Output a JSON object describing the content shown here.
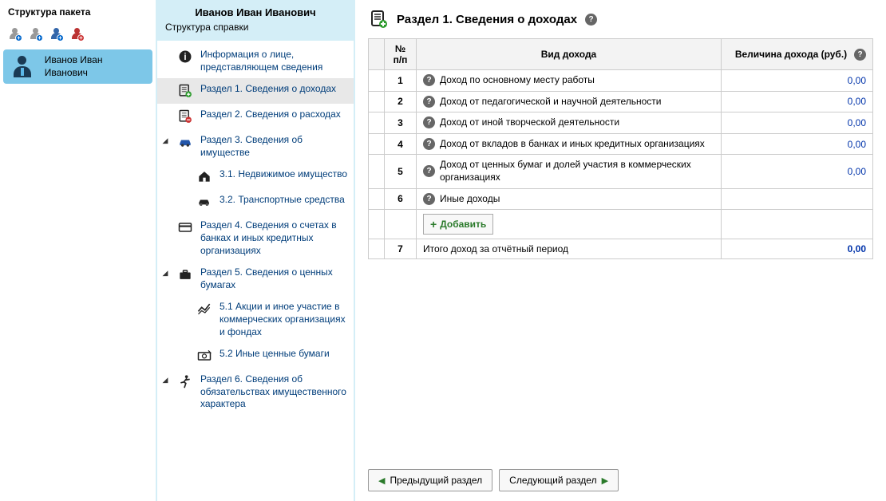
{
  "leftPanel": {
    "title": "Структура пакета",
    "personName": "Иванов Иван Иванович"
  },
  "midPanel": {
    "title": "Иванов Иван Иванович",
    "subtitle": "Структура справки",
    "items": [
      {
        "arrow": "",
        "icon": "info",
        "label": "Информация о лице, представляющем сведения",
        "sub": false
      },
      {
        "arrow": "",
        "icon": "doc-plus",
        "label": "Раздел 1. Сведения о доходах",
        "sub": false,
        "active": true
      },
      {
        "arrow": "",
        "icon": "doc-minus",
        "label": "Раздел 2. Сведения о расходах",
        "sub": false
      },
      {
        "arrow": "◢",
        "icon": "car",
        "label": "Раздел 3. Сведения об имуществе",
        "sub": false
      },
      {
        "arrow": "",
        "icon": "house",
        "label": "3.1. Недвижимое имущество",
        "sub": true
      },
      {
        "arrow": "",
        "icon": "car2",
        "label": "3.2. Транспортные средства",
        "sub": true
      },
      {
        "arrow": "",
        "icon": "card",
        "label": "Раздел 4. Сведения о счетах в банках и иных кредитных организациях",
        "sub": false
      },
      {
        "arrow": "◢",
        "icon": "briefcase",
        "label": "Раздел 5. Сведения о ценных бумагах",
        "sub": false
      },
      {
        "arrow": "",
        "icon": "chart",
        "label": "5.1 Акции и иное участие в коммерческих организациях и фондах",
        "sub": true
      },
      {
        "arrow": "",
        "icon": "money",
        "label": "5.2 Иные ценные бумаги",
        "sub": true
      },
      {
        "arrow": "◢",
        "icon": "runner",
        "label": "Раздел 6. Сведения об обязательствах имущественного характера",
        "sub": false
      }
    ]
  },
  "main": {
    "title": "Раздел 1. Сведения о доходах",
    "headers": {
      "num": "№ п/п",
      "type": "Вид дохода",
      "amount": "Величина дохода (руб.)"
    },
    "rows": [
      {
        "num": "1",
        "type": "Доход по основному месту работы",
        "amount": "0,00",
        "help": true
      },
      {
        "num": "2",
        "type": "Доход от педагогической и научной деятельности",
        "amount": "0,00",
        "help": true
      },
      {
        "num": "3",
        "type": "Доход от иной творческой деятельности",
        "amount": "0,00",
        "help": true
      },
      {
        "num": "4",
        "type": "Доход от вкладов в банках и иных кредитных организациях",
        "amount": "0,00",
        "help": true
      },
      {
        "num": "5",
        "type": "Доход от ценных бумаг и долей участия в коммерческих организациях",
        "amount": "0,00",
        "help": true
      },
      {
        "num": "6",
        "type": "Иные доходы",
        "amount": "",
        "help": true
      }
    ],
    "addBtn": "Добавить",
    "total": {
      "num": "7",
      "type": "Итого доход за отчётный период",
      "amount": "0,00"
    },
    "prevBtn": "Предыдущий раздел",
    "nextBtn": "Следующий раздел"
  }
}
